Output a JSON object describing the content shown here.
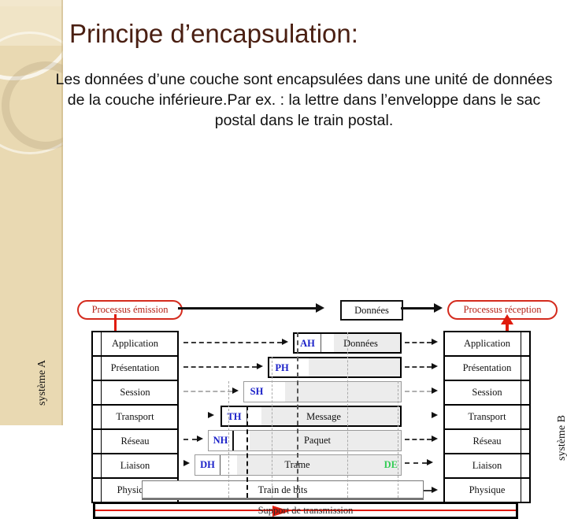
{
  "slide": {
    "title": "Principe d’encapsulation:",
    "body": "Les données d’une couche sont encapsulées dans une unité de données de la couche inférieure.Par ex. : la lettre dans l’enveloppe dans le sac postal dans le train postal.",
    "title_color": "#4a1f12",
    "sidebar_color": "#e9d9b2",
    "accent_red": "#e01b0c",
    "header_blue": "#1a20c8",
    "trailer_green": "#33cc55"
  },
  "diagram": {
    "emission_process": "Processus émission",
    "reception_process": "Processus réception",
    "top_data_box": "Données",
    "system_a_label": "système A",
    "system_b_label": "système B",
    "support_label": "Support de transmission",
    "bit_train_label": "Train de bits",
    "layers": [
      "Application",
      "Présentation",
      "Session",
      "Transport",
      "Réseau",
      "Liaison",
      "Physique"
    ],
    "pdus": [
      {
        "header": "AH",
        "name": "Données",
        "trailer": ""
      },
      {
        "header": "PH",
        "name": "",
        "trailer": ""
      },
      {
        "header": "SH",
        "name": "",
        "trailer": ""
      },
      {
        "header": "TH",
        "name": "Message",
        "trailer": ""
      },
      {
        "header": "NH",
        "name": "Paquet",
        "trailer": ""
      },
      {
        "header": "DH",
        "name": "Trame",
        "trailer": "DE"
      }
    ]
  }
}
